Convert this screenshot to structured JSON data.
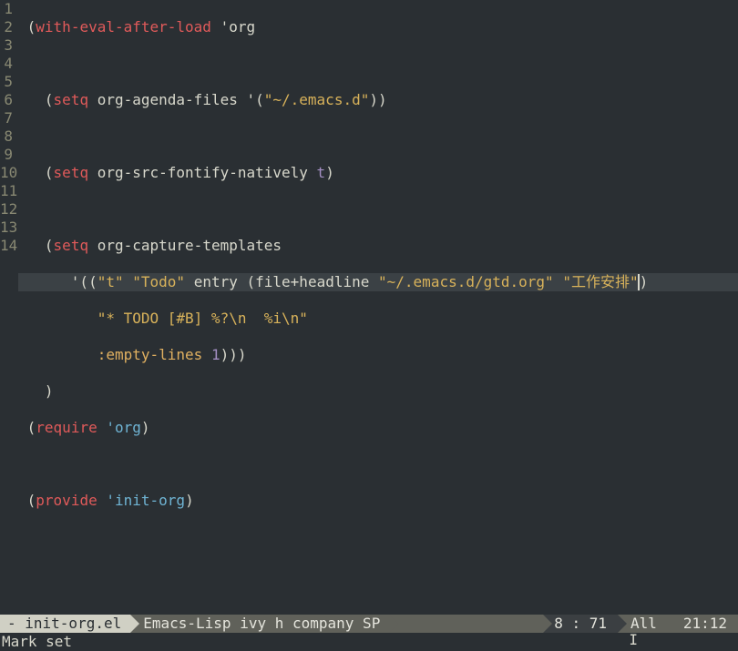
{
  "gutter": [
    "1",
    "2",
    "3",
    "4",
    "5",
    "6",
    "7",
    "8",
    "9",
    "10",
    "11",
    "12",
    "13",
    "14"
  ],
  "code": {
    "l1": {
      "kw": "with-eval-after-load",
      "arg": "'org"
    },
    "l3": {
      "kw": "setq",
      "sym": "org-agenda-files",
      "str": "\"~/.emacs.d\""
    },
    "l5": {
      "kw": "setq",
      "sym": "org-src-fontify-natively",
      "const": "t"
    },
    "l7": {
      "kw": "setq",
      "sym": "org-capture-templates"
    },
    "l8": {
      "s1": "\"t\"",
      "s2": "\"Todo\"",
      "entry": "entry",
      "fh": "file+headline",
      "s3": "\"~/.emacs.d/gtd.org\"",
      "s4": "\"工作安排\""
    },
    "l9": {
      "str": "\"* TODO [#B] %?\\n  %i\\n\""
    },
    "l10": {
      "key": ":empty-lines",
      "num": "1"
    },
    "l12": {
      "kw": "require",
      "org": "'org"
    },
    "l14": {
      "kw": "provide",
      "org": "'init-org"
    }
  },
  "modeline": {
    "file": "- init-org.el",
    "modes": "Emacs-Lisp ivy h company SP",
    "pos": "8 : 71",
    "scroll": "All",
    "time": "21:12"
  },
  "minibuffer": "Mark set"
}
